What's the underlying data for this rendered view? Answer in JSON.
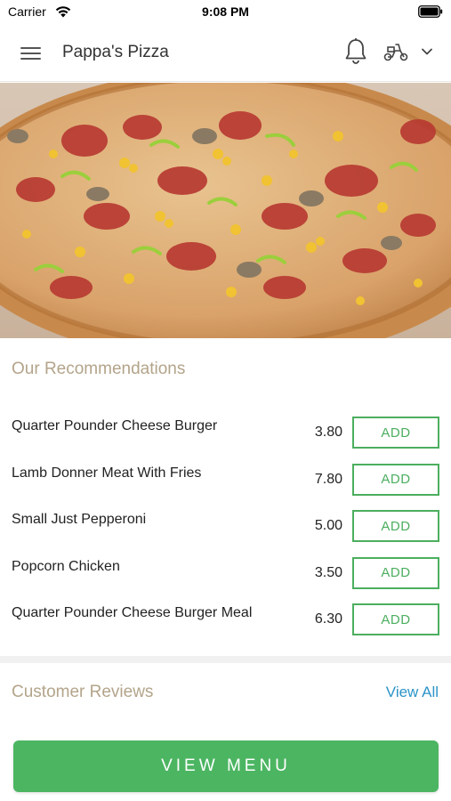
{
  "status_bar": {
    "carrier": "Carrier",
    "time": "9:08 PM",
    "wifi_icon": "wifi-icon",
    "battery_icon": "battery-icon"
  },
  "header": {
    "title": "Pappa's Pizza",
    "menu_icon": "hamburger-menu-icon",
    "notification_icon": "bell-icon",
    "delivery_icon": "scooter-icon",
    "dropdown_icon": "chevron-down-icon"
  },
  "hero": {
    "image": "pizza-photo"
  },
  "recommendations": {
    "title": "Our Recommendations",
    "items": [
      {
        "name": "Quarter Pounder Cheese Burger",
        "price": "3.80",
        "button": "ADD"
      },
      {
        "name": "Lamb Donner Meat With Fries",
        "price": "7.80",
        "button": "ADD"
      },
      {
        "name": "Small Just Pepperoni",
        "price": "5.00",
        "button": "ADD"
      },
      {
        "name": "Popcorn Chicken",
        "price": "3.50",
        "button": "ADD"
      },
      {
        "name": "Quarter Pounder Cheese Burger Meal",
        "price": "6.30",
        "button": "ADD"
      }
    ]
  },
  "reviews": {
    "title": "Customer Reviews",
    "view_all": "View All"
  },
  "footer": {
    "view_menu": "VIEW MENU"
  },
  "colors": {
    "accent_green": "#4cb562",
    "section_title": "#b3a48a",
    "link_blue": "#2d94c8"
  }
}
